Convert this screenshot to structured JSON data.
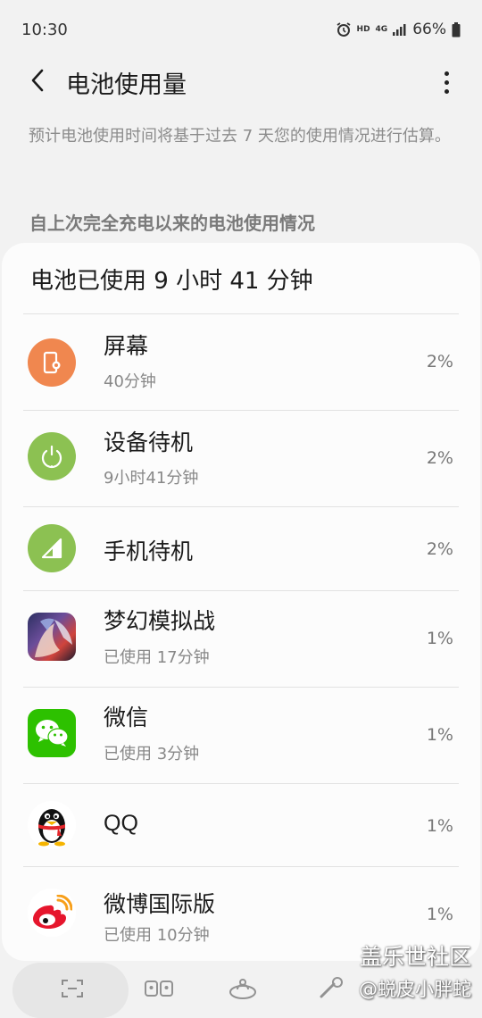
{
  "status_bar": {
    "time": "10:30",
    "hd_label": "HD",
    "network_label": "4G",
    "battery_percent": "66%",
    "icons": [
      "alarm-icon",
      "hd-icon",
      "4g-icon",
      "signal-icon",
      "battery-icon"
    ]
  },
  "header": {
    "title": "电池使用量",
    "back_icon": "back-arrow-icon",
    "more_icon": "more-vertical-icon"
  },
  "description": "预计电池使用时间将基于过去 7 天您的使用情况进行估算。",
  "section_heading": "自上次完全充电以来的电池使用情况",
  "usage_summary": "电池已使用 9 小时 41 分钟",
  "apps": [
    {
      "name": "屏幕",
      "sub": "40分钟",
      "percent": "2%",
      "icon": "screen-icon",
      "color": "#f0874f"
    },
    {
      "name": "设备待机",
      "sub": "9小时41分钟",
      "percent": "2%",
      "icon": "power-icon",
      "color": "#8cc152"
    },
    {
      "name": "手机待机",
      "sub": "",
      "percent": "2%",
      "icon": "signal-icon",
      "color": "#8cc152"
    },
    {
      "name": "梦幻模拟战",
      "sub": "已使用 17分钟",
      "percent": "1%",
      "icon": "game-app-icon",
      "color": "#3a3f78"
    },
    {
      "name": "微信",
      "sub": "已使用 3分钟",
      "percent": "1%",
      "icon": "wechat-icon",
      "color": "#2dc100"
    },
    {
      "name": "QQ",
      "sub": "",
      "percent": "1%",
      "icon": "qq-penguin-icon",
      "color": "#111111"
    },
    {
      "name": "微博国际版",
      "sub": "已使用 10分钟",
      "percent": "1%",
      "icon": "weibo-icon",
      "color": "#e6162d"
    }
  ],
  "watermark": {
    "line1": "盖乐世社区",
    "line2": "@蜕皮小胖蛇"
  },
  "bottom_nav": {
    "items": [
      "scan-icon",
      "cleaner-icon",
      "battery-care-icon",
      "tools-icon"
    ]
  }
}
